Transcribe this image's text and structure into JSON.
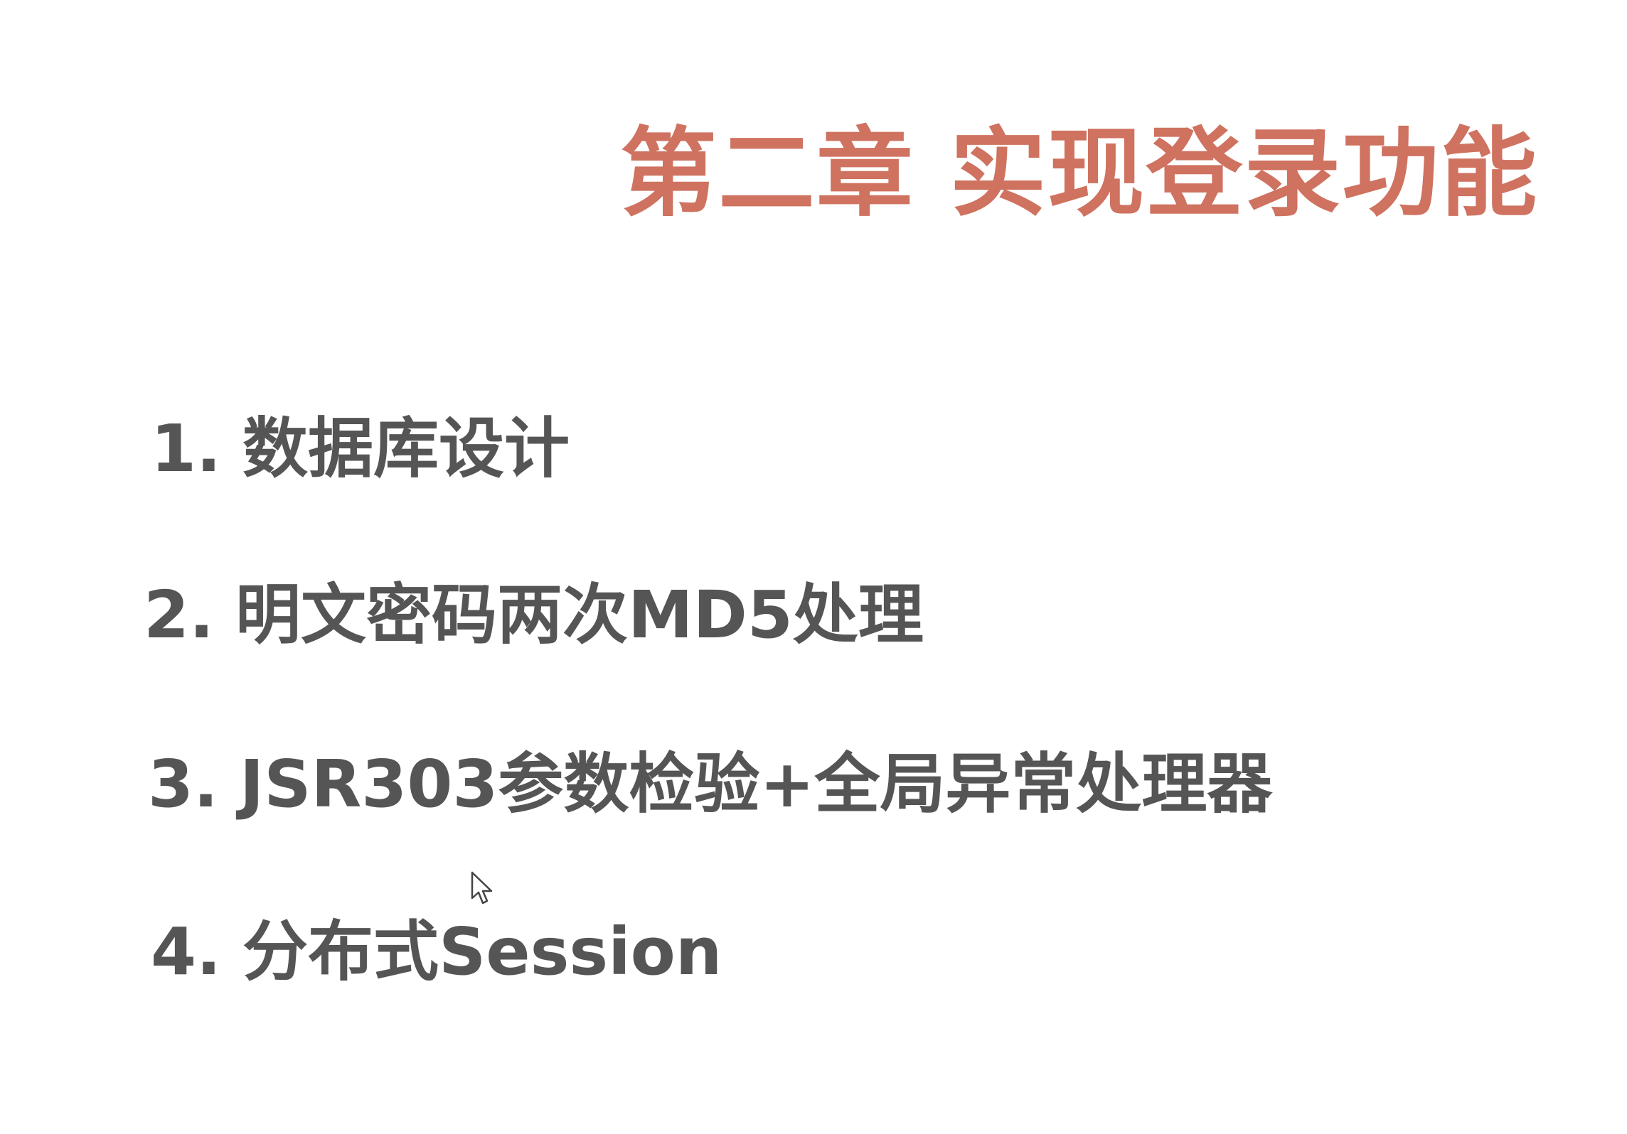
{
  "slide": {
    "title": "第二章 实现登录功能",
    "items": [
      {
        "number": "1.",
        "text": "数据库设计"
      },
      {
        "number": "2.",
        "text": "明文密码两次MD5处理"
      },
      {
        "number": "3.",
        "text": "JSR303参数检验+全局异常处理器"
      },
      {
        "number": "4.",
        "text": "分布式Session"
      }
    ]
  },
  "colors": {
    "title": "#cf7260",
    "body_text": "#555555",
    "background": "#ffffff"
  },
  "icons": {
    "cursor": "mouse-pointer-icon"
  }
}
